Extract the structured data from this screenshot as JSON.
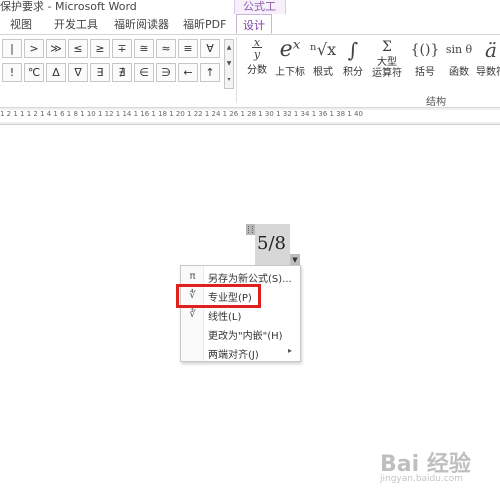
{
  "window": {
    "title": "保护要求 - Microsoft Word",
    "context_group": "公式工具"
  },
  "tabs": [
    {
      "label": "视图"
    },
    {
      "label": "开发工具"
    },
    {
      "label": "福昕阅读器"
    },
    {
      "label": "福昕PDF"
    },
    {
      "label": "设计"
    }
  ],
  "ribbon": {
    "symbols_row1": [
      "|",
      ">",
      "≫",
      "≤",
      "≥",
      "∓",
      "≅",
      "≈",
      "≡",
      "∀"
    ],
    "symbols_row2": [
      "!",
      "℃",
      "Δ",
      "∇",
      "∃",
      "∄",
      "∈",
      "∋",
      "←",
      "↑"
    ],
    "structures": [
      {
        "glyph": "x/y",
        "label": "分数"
      },
      {
        "glyph": "eˣ",
        "label": "上下标"
      },
      {
        "glyph": "ⁿ√x",
        "label": "根式"
      },
      {
        "glyph": "∫",
        "label": "积分"
      },
      {
        "glyph": "Σ",
        "label": "大型\n运算符"
      },
      {
        "glyph": "{()}",
        "label": "括号"
      },
      {
        "glyph": "sin θ",
        "label": "函数"
      },
      {
        "glyph": "ä",
        "label": "导数符"
      }
    ],
    "group_label": "结构"
  },
  "ruler": {
    "marks": "1 2 1 1 1 2 1 4 1 6 1 8 1 10 1 12 1 14 1 16 1 18 1 20 1 22 1 24 1 26 1 28 1 30 1 32 1 34 1 36 1 38 1 40"
  },
  "document": {
    "equation": "5/8"
  },
  "context_menu": {
    "items": [
      {
        "icon": "save-as-new-equation-icon",
        "label": "另存为新公式(S)..."
      },
      {
        "icon": "professional-format-icon",
        "label": "专业型(P)"
      },
      {
        "icon": "linear-format-icon",
        "label": "线性(L)"
      },
      {
        "icon": "",
        "label": "更改为\"内嵌\"(H)"
      },
      {
        "icon": "",
        "label": "两端对齐(J)",
        "submenu": "▸"
      }
    ]
  },
  "colors": {
    "accent": "#7a3fa6",
    "highlight_border": "#e0201e"
  },
  "watermark": {
    "text": "Bai 经验",
    "url": "jingyan.baidu.com"
  }
}
